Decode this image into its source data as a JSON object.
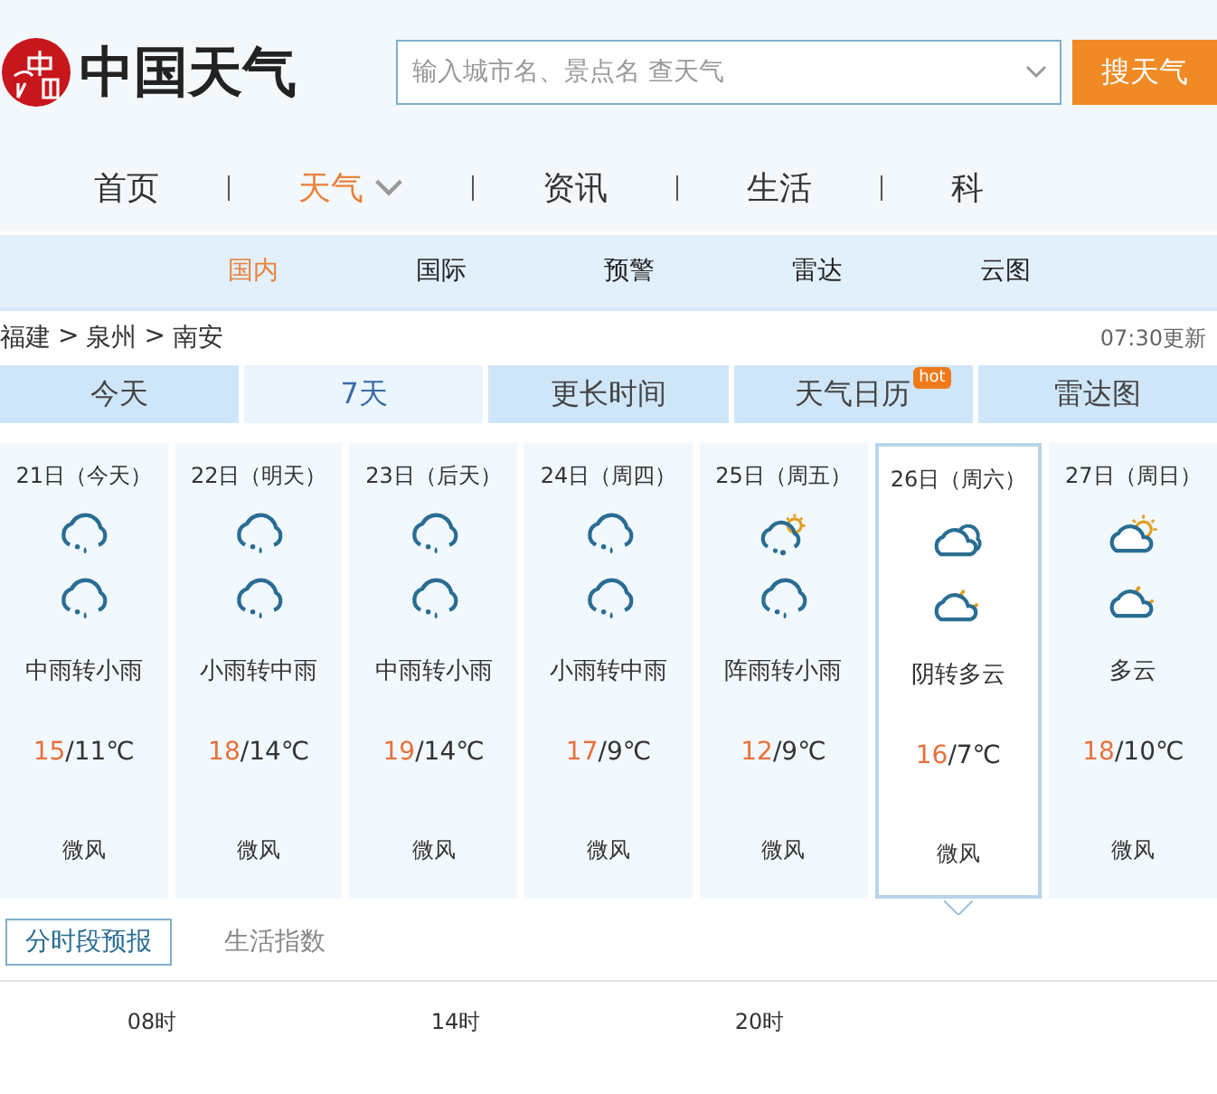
{
  "logo": {
    "text": "中国天气"
  },
  "search": {
    "placeholder": "输入城市名、景点名 查天气",
    "button": "搜天气"
  },
  "nav": [
    {
      "label": "首页",
      "selected": false,
      "dropdown": false
    },
    {
      "label": "天气",
      "selected": true,
      "dropdown": true
    },
    {
      "label": "资讯",
      "selected": false,
      "dropdown": false
    },
    {
      "label": "生活",
      "selected": false,
      "dropdown": false
    },
    {
      "label": "科",
      "selected": false,
      "dropdown": false
    }
  ],
  "subnav": [
    {
      "label": "国内",
      "selected": true
    },
    {
      "label": "国际",
      "selected": false
    },
    {
      "label": "预警",
      "selected": false
    },
    {
      "label": "雷达",
      "selected": false
    },
    {
      "label": "云图",
      "selected": false
    }
  ],
  "breadcrumb": [
    "福建",
    ">",
    "泉州",
    ">",
    "南安"
  ],
  "updated": "07:30更新",
  "tabs": [
    {
      "label": "今天",
      "selected": false
    },
    {
      "label": "7天",
      "selected": true
    },
    {
      "label": "更长时间",
      "selected": false
    },
    {
      "label": "天气日历",
      "selected": false,
      "badge": "hot"
    },
    {
      "label": "雷达图",
      "selected": false
    }
  ],
  "days": [
    {
      "date": "21日（今天）",
      "day_icon": {
        "kind": "rain"
      },
      "night_icon": {
        "kind": "rain"
      },
      "weather": "中雨转小雨",
      "high": "15",
      "low": "/11℃",
      "wind": "微风",
      "selected": false
    },
    {
      "date": "22日（明天）",
      "day_icon": {
        "kind": "rain"
      },
      "night_icon": {
        "kind": "rain"
      },
      "weather": "小雨转中雨",
      "high": "18",
      "low": "/14℃",
      "wind": "微风",
      "selected": false
    },
    {
      "date": "23日（后天）",
      "day_icon": {
        "kind": "rain"
      },
      "night_icon": {
        "kind": "rain"
      },
      "weather": "中雨转小雨",
      "high": "19",
      "low": "/14℃",
      "wind": "微风",
      "selected": false
    },
    {
      "date": "24日（周四）",
      "day_icon": {
        "kind": "rain"
      },
      "night_icon": {
        "kind": "rain"
      },
      "weather": "小雨转中雨",
      "high": "17",
      "low": "/9℃",
      "wind": "微风",
      "selected": false
    },
    {
      "date": "25日（周五）",
      "day_icon": {
        "kind": "shower"
      },
      "night_icon": {
        "kind": "rain"
      },
      "weather": "阵雨转小雨",
      "high": "12",
      "low": "/9℃",
      "wind": "微风",
      "selected": false
    },
    {
      "date": "26日（周六）",
      "day_icon": {
        "kind": "overcast"
      },
      "night_icon": {
        "kind": "cloudy-night"
      },
      "weather": "阴转多云",
      "high": "16",
      "low": "/7℃",
      "wind": "微风",
      "selected": true
    },
    {
      "date": "27日（周日）",
      "day_icon": {
        "kind": "cloudy-day"
      },
      "night_icon": {
        "kind": "cloudy-night"
      },
      "weather": "多云",
      "high": "18",
      "low": "/10℃",
      "wind": "微风",
      "selected": false
    }
  ],
  "detail_tabs": [
    {
      "label": "分时段预报",
      "selected": true
    },
    {
      "label": "生活指数",
      "selected": false
    }
  ],
  "hours": [
    "08时",
    "14时",
    "20时"
  ]
}
